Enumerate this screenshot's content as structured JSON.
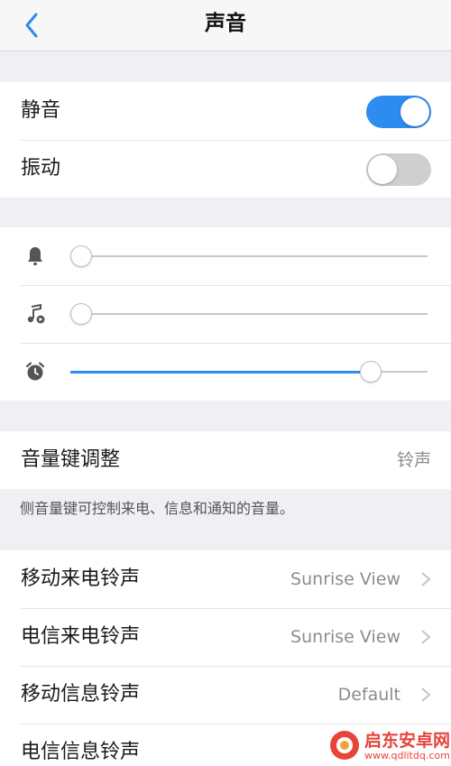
{
  "header": {
    "title": "声音"
  },
  "toggles": [
    {
      "label": "静音",
      "state": "on"
    },
    {
      "label": "振动",
      "state": "off"
    }
  ],
  "volumes": [
    {
      "icon": "bell-icon",
      "level": 0.0
    },
    {
      "icon": "music-note-icon",
      "level": 0.0
    },
    {
      "icon": "alarm-clock-icon",
      "level": 0.84
    }
  ],
  "volume_key": {
    "label": "音量键调整",
    "value": "铃声",
    "footnote": "侧音量键可控制来电、信息和通知的音量。"
  },
  "ringtones": [
    {
      "label": "移动来电铃声",
      "value": "Sunrise View"
    },
    {
      "label": "电信来电铃声",
      "value": "Sunrise View"
    },
    {
      "label": "移动信息铃声",
      "value": "Default"
    },
    {
      "label": "电信信息铃声",
      "value": ""
    }
  ],
  "colors": {
    "accent": "#2d8cf0",
    "background": "#efeff4",
    "watermark": "#e8443a"
  },
  "watermark": {
    "text": "启东安卓网",
    "url": "www.qdlitdq.com"
  }
}
